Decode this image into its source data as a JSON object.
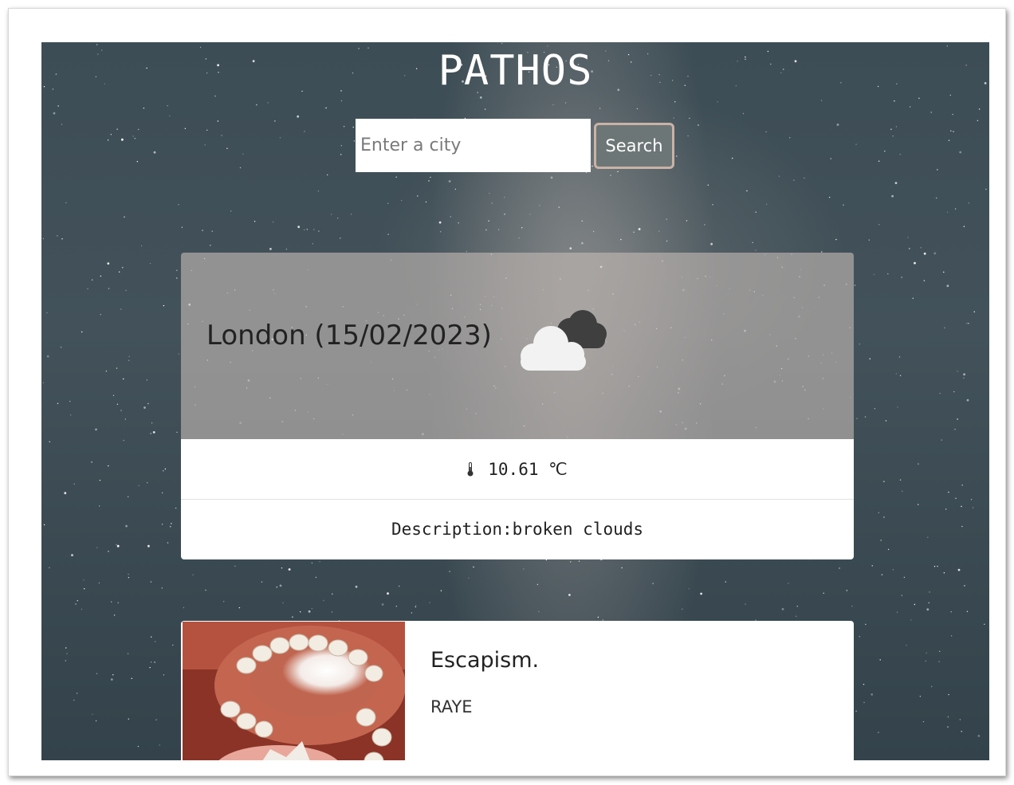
{
  "app": {
    "title": "PATHOS"
  },
  "search": {
    "placeholder": "Enter a city",
    "value": "",
    "button_label": "Search"
  },
  "weather": {
    "city_date": "London (15/02/2023)",
    "icon": "broken-clouds-icon",
    "temperature": "10.61 ℃",
    "description": "Description:broken clouds"
  },
  "song": {
    "title": "Escapism.",
    "artist": "RAYE",
    "art_icon": "album-art-image"
  },
  "colors": {
    "search_button_bg": "#6d7676",
    "search_button_border": "#c9b2a6",
    "header_overlay": "#c3b9b4"
  }
}
